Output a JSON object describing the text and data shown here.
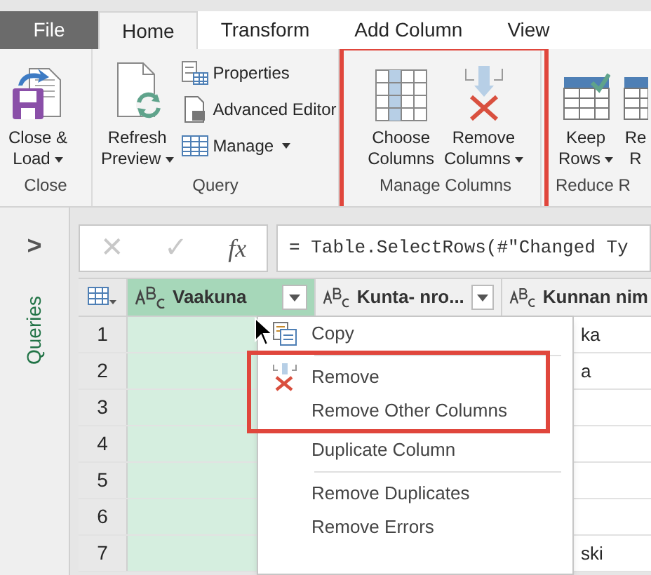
{
  "tabs": [
    {
      "label": "File",
      "kind": "file",
      "selected": false
    },
    {
      "label": "Home",
      "kind": "tab",
      "selected": true
    },
    {
      "label": "Transform",
      "kind": "tab",
      "selected": false
    },
    {
      "label": "Add Column",
      "kind": "tab",
      "selected": false
    },
    {
      "label": "View",
      "kind": "tab",
      "selected": false
    }
  ],
  "ribbon_groups": [
    {
      "label": "Close",
      "highlighted": false,
      "buttons": [
        {
          "kind": "large",
          "lines": [
            "Close &",
            "Load"
          ],
          "dropdown": true
        }
      ]
    },
    {
      "label": "Query",
      "highlighted": false,
      "buttons": [
        {
          "kind": "large",
          "lines": [
            "Refresh",
            "Preview"
          ],
          "dropdown": true
        },
        {
          "kind": "small",
          "lines": [
            "Properties"
          ],
          "dropdown": false
        },
        {
          "kind": "small",
          "lines": [
            "Advanced Editor"
          ],
          "dropdown": false
        },
        {
          "kind": "small",
          "lines": [
            "Manage"
          ],
          "dropdown": true
        }
      ]
    },
    {
      "label": "Manage Columns",
      "highlighted": true,
      "buttons": [
        {
          "kind": "large",
          "lines": [
            "Choose",
            "Columns"
          ],
          "dropdown": false
        },
        {
          "kind": "large",
          "lines": [
            "Remove",
            "Columns"
          ],
          "dropdown": true
        }
      ]
    },
    {
      "label": "Reduce R",
      "highlighted": false,
      "buttons": [
        {
          "kind": "large",
          "lines": [
            "Keep",
            "Rows"
          ],
          "dropdown": true
        },
        {
          "kind": "large",
          "lines": [
            "Re",
            "R"
          ],
          "dropdown": false
        }
      ]
    }
  ],
  "queries_pane": {
    "label": "Queries",
    "toggle": ">"
  },
  "formula_bar": {
    "cancel": "✕",
    "confirm": "✓",
    "fx": "fx",
    "formula": "= Table.SelectRows(#\"Changed Ty"
  },
  "table": {
    "columns": [
      {
        "name": "Vaakuna",
        "selected": true
      },
      {
        "name": "Kunta- nro...",
        "selected": false
      },
      {
        "name": "Kunnan nim",
        "selected": false
      }
    ],
    "rows": [
      {
        "number": "1",
        "column_3": "ka"
      },
      {
        "number": "2",
        "column_3": "a"
      },
      {
        "number": "3",
        "column_3": ""
      },
      {
        "number": "4",
        "column_3": ""
      },
      {
        "number": "5",
        "column_3": ""
      },
      {
        "number": "6",
        "column_3": ""
      },
      {
        "number": "7",
        "column_3": "ski"
      }
    ]
  },
  "context_menu": {
    "items": [
      {
        "label": "Copy",
        "separator_before": false
      },
      {
        "label": "Remove",
        "separator_before": true
      },
      {
        "label": "Remove Other Columns",
        "separator_before": false
      },
      {
        "label": "Duplicate Column",
        "separator_before": false
      },
      {
        "label": "Remove Duplicates",
        "separator_before": true
      },
      {
        "label": "Remove Errors",
        "separator_before": false
      }
    ]
  }
}
